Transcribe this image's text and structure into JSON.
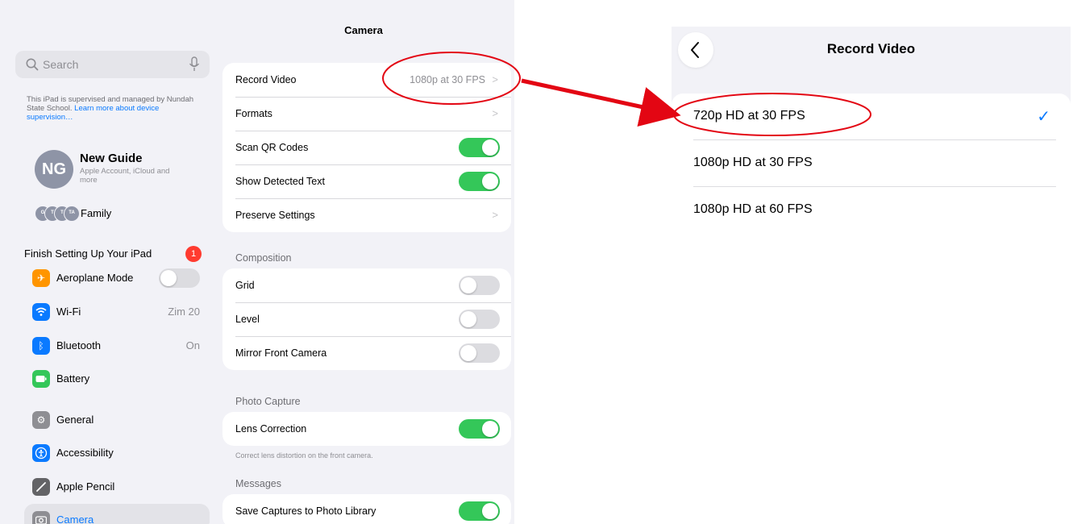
{
  "sidebar": {
    "search_placeholder": "Search",
    "supervision_text": "This iPad is supervised and managed by Nundah State School.",
    "supervision_link": "Learn more about device supervision…",
    "account": {
      "initials": "NG",
      "name": "New Guide",
      "subtitle": "Apple Account, iCloud and more"
    },
    "family": {
      "avatars": [
        "G",
        "T",
        "T",
        "TA"
      ],
      "label": "Family"
    },
    "finish_setup": {
      "label": "Finish Setting Up Your iPad",
      "badge": "1"
    },
    "items": [
      {
        "label": "Aeroplane Mode",
        "icon": "airplane-icon",
        "color": "#ff9500",
        "value": ""
      },
      {
        "label": "Wi-Fi",
        "icon": "wifi-icon",
        "color": "#0a7aff",
        "value": "Zim 20"
      },
      {
        "label": "Bluetooth",
        "icon": "bluetooth-icon",
        "color": "#0a7aff",
        "value": "On"
      },
      {
        "label": "Battery",
        "icon": "battery-icon",
        "color": "#34c759",
        "value": ""
      },
      {
        "label": "General",
        "icon": "gear-icon",
        "color": "#8e8e93",
        "value": ""
      },
      {
        "label": "Accessibility",
        "icon": "accessibility-icon",
        "color": "#0a7aff",
        "value": ""
      },
      {
        "label": "Apple Pencil",
        "icon": "pencil-icon",
        "color": "#636366",
        "value": ""
      },
      {
        "label": "Camera",
        "icon": "camera-icon",
        "color": "#8e8e93",
        "value": ""
      }
    ]
  },
  "main": {
    "title": "Camera",
    "group1": [
      {
        "label": "Record Video",
        "value": "1080p at 30 FPS",
        "type": "disclosure"
      },
      {
        "label": "Formats",
        "value": "",
        "type": "disclosure"
      },
      {
        "label": "Scan QR Codes",
        "type": "toggle",
        "on": true
      },
      {
        "label": "Show Detected Text",
        "type": "toggle",
        "on": true
      },
      {
        "label": "Preserve Settings",
        "value": "",
        "type": "disclosure"
      }
    ],
    "composition_header": "Composition",
    "composition": [
      {
        "label": "Grid",
        "type": "toggle",
        "on": false
      },
      {
        "label": "Level",
        "type": "toggle",
        "on": false
      },
      {
        "label": "Mirror Front Camera",
        "type": "toggle",
        "on": false
      }
    ],
    "photo_capture_header": "Photo Capture",
    "photo_capture": [
      {
        "label": "Lens Correction",
        "type": "toggle",
        "on": true
      }
    ],
    "photo_capture_footnote": "Correct lens distortion on the front camera.",
    "messages_header": "Messages",
    "messages": [
      {
        "label": "Save Captures to Photo Library",
        "type": "toggle",
        "on": true
      }
    ]
  },
  "record_video": {
    "title": "Record Video",
    "options": [
      {
        "label": "720p HD at 30 FPS",
        "selected": true
      },
      {
        "label": "1080p HD at 30 FPS",
        "selected": false
      },
      {
        "label": "1080p HD at 60 FPS",
        "selected": false
      }
    ]
  },
  "annotation": {
    "color": "#e30613"
  }
}
